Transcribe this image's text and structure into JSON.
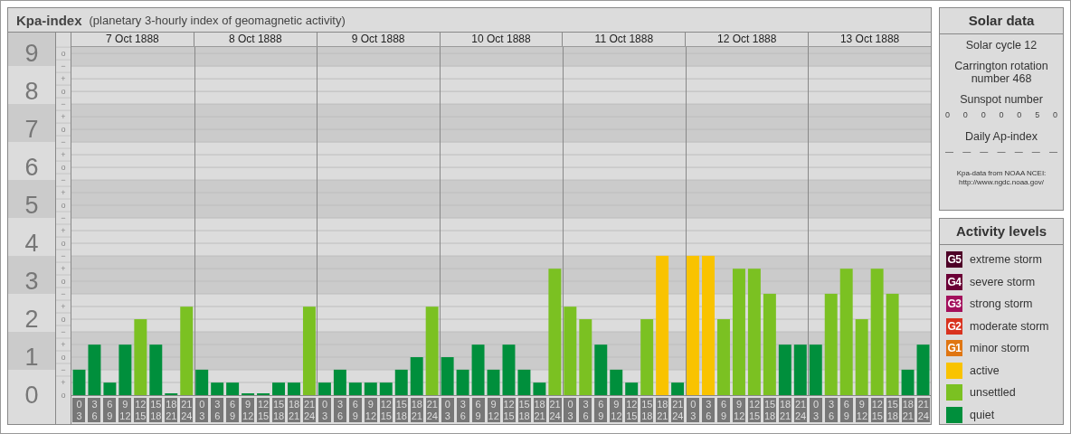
{
  "title": {
    "name": "Kpa-index",
    "subtitle": "(planetary 3-hourly index of geomagnetic activity)"
  },
  "days": [
    "7 Oct 1888",
    "8 Oct 1888",
    "9 Oct 1888",
    "10 Oct 1888",
    "11 Oct 1888",
    "12 Oct 1888",
    "13 Oct 1888"
  ],
  "scale_marks": [
    "o",
    "−",
    "+",
    "o",
    "−",
    "+",
    "o",
    "−",
    "+",
    "o",
    "−",
    "+",
    "o",
    "−",
    "+",
    "o",
    "−",
    "+",
    "o",
    "−",
    "+",
    "o",
    "−",
    "+",
    "o",
    "−",
    "+",
    "o"
  ],
  "chart_data": {
    "type": "bar",
    "stacked": true,
    "grid": true,
    "ylim": [
      0,
      9.17
    ],
    "categories": [
      "0 3",
      "3 6",
      "6 9",
      "9 12",
      "12 15",
      "15 18",
      "18 21",
      "21 24",
      "0 3",
      "3 6",
      "6 9",
      "9 12",
      "12 15",
      "15 18",
      "18 21",
      "21 24",
      "0 3",
      "3 6",
      "6 9",
      "9 12",
      "12 15",
      "15 18",
      "18 21",
      "21 24",
      "0 3",
      "3 6",
      "6 9",
      "9 12",
      "12 15",
      "15 18",
      "18 21",
      "21 24",
      "0 3",
      "3 6",
      "6 9",
      "9 12",
      "12 15",
      "15 18",
      "18 21",
      "21 24",
      "0 3",
      "3 6",
      "6 9",
      "9 12",
      "12 15",
      "15 18",
      "18 21",
      "21 24",
      "0 3",
      "3 6",
      "6 9",
      "9 12",
      "12 15",
      "15 18",
      "18 21",
      "21 24"
    ],
    "yticks": [
      0,
      1,
      2,
      3,
      4,
      5,
      6,
      7,
      8,
      9
    ],
    "series": [
      {
        "name": "quiet",
        "color": "#008f3c",
        "values": [
          0.67,
          1.33,
          0.33,
          1.33,
          null,
          1.33,
          0,
          null,
          0.67,
          0.33,
          0.33,
          0,
          0,
          0.33,
          0.33,
          null,
          0.33,
          0.67,
          0.33,
          0.33,
          0.33,
          0.67,
          1,
          null,
          1,
          0.67,
          1.33,
          0.67,
          1.33,
          0.67,
          0.33,
          null,
          null,
          null,
          1.33,
          0.67,
          0.33,
          null,
          null,
          0.33,
          null,
          null,
          null,
          null,
          null,
          null,
          1.33,
          1.33,
          1.33,
          null,
          null,
          null,
          null,
          null,
          0.67,
          1.33
        ]
      },
      {
        "name": "unsettled",
        "color": "#7bc122",
        "values": [
          null,
          null,
          null,
          null,
          2,
          null,
          null,
          2.33,
          null,
          null,
          null,
          null,
          null,
          null,
          null,
          2.33,
          null,
          null,
          null,
          null,
          null,
          null,
          null,
          2.33,
          null,
          null,
          null,
          null,
          null,
          null,
          null,
          3.33,
          2.33,
          2,
          null,
          null,
          null,
          2,
          null,
          null,
          null,
          null,
          2,
          3.33,
          3.33,
          2.67,
          null,
          null,
          null,
          2.67,
          3.33,
          2,
          3.33,
          2.67,
          null,
          null
        ]
      },
      {
        "name": "active",
        "color": "#f9c300",
        "values": [
          null,
          null,
          null,
          null,
          null,
          null,
          null,
          null,
          null,
          null,
          null,
          null,
          null,
          null,
          null,
          null,
          null,
          null,
          null,
          null,
          null,
          null,
          null,
          null,
          null,
          null,
          null,
          null,
          null,
          null,
          null,
          null,
          null,
          null,
          null,
          null,
          null,
          null,
          3.67,
          null,
          3.67,
          3.67,
          null,
          null,
          null,
          null,
          null,
          null,
          null,
          null,
          null,
          null,
          null,
          null,
          null,
          null
        ]
      }
    ]
  },
  "solar_data": {
    "title": "Solar data",
    "solar_cycle": "Solar cycle 12",
    "carrington": "Carrington rotation number 468",
    "sunspot_label": "Sunspot number",
    "sunspot_numbers": [
      "0",
      "0",
      "0",
      "0",
      "0",
      "5",
      "0"
    ],
    "ap_label": "Daily Ap-index",
    "ap_values": [
      "—",
      "—",
      "—",
      "—",
      "—",
      "—",
      "—"
    ],
    "source_label": "Kpa-data from NOAA NCEI:",
    "source_url": "http://www.ngdc.noaa.gov/"
  },
  "activity_levels": {
    "title": "Activity levels",
    "items": [
      {
        "badge": "G5",
        "label": "extreme storm",
        "color": "#4d0026"
      },
      {
        "badge": "G4",
        "label": "severe storm",
        "color": "#6b0036"
      },
      {
        "badge": "G3",
        "label": "strong storm",
        "color": "#a3105c"
      },
      {
        "badge": "G2",
        "label": "moderate storm",
        "color": "#d9321e"
      },
      {
        "badge": "G1",
        "label": "minor storm",
        "color": "#e07612"
      }
    ]
  }
}
